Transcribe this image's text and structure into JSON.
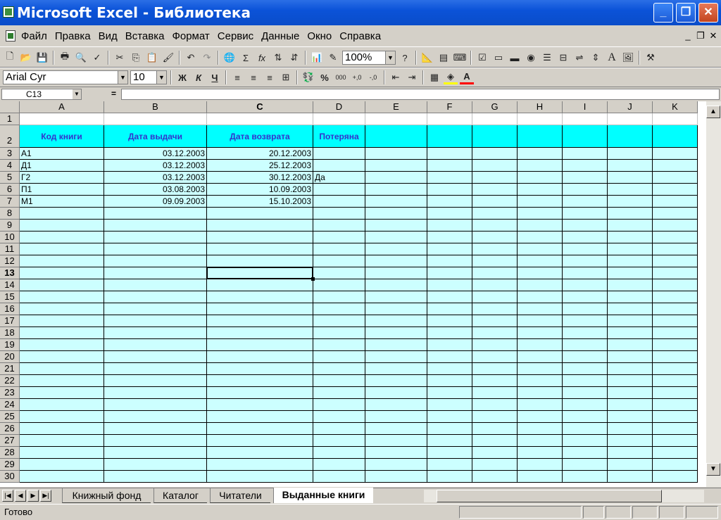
{
  "window": {
    "title": "Microsoft Excel - Библиотека"
  },
  "menu": {
    "items": [
      "Файл",
      "Правка",
      "Вид",
      "Вставка",
      "Формат",
      "Сервис",
      "Данные",
      "Окно",
      "Справка"
    ]
  },
  "toolbar": {
    "zoom": "100%",
    "font_name": "Arial Cyr",
    "font_size": "10",
    "bold_label": "Ж",
    "italic_label": "К",
    "underline_label": "Ч",
    "percent_label": "%",
    "thousands_label": "000",
    "sum_label": "Σ",
    "fx_label": "fx"
  },
  "formula_bar": {
    "name_box": "C13",
    "equals": "=",
    "value": ""
  },
  "grid": {
    "columns": [
      "A",
      "B",
      "C",
      "D",
      "E",
      "F",
      "G",
      "H",
      "I",
      "J",
      "K"
    ],
    "rows": [
      "1",
      "2",
      "3",
      "4",
      "5",
      "6",
      "7",
      "8",
      "9",
      "10",
      "11",
      "12",
      "13",
      "14",
      "15",
      "16",
      "17",
      "18",
      "19",
      "20",
      "21",
      "22",
      "23",
      "24",
      "25",
      "26",
      "27",
      "28",
      "29",
      "30"
    ],
    "selected_cell": "C13",
    "header_row": [
      "Код книги",
      "Дата выдачи",
      "Дата возврата",
      "Потеряна"
    ],
    "data": [
      [
        "А1",
        "03.12.2003",
        "20.12.2003",
        ""
      ],
      [
        "Д1",
        "03.12.2003",
        "25.12.2003",
        ""
      ],
      [
        "Г2",
        "03.12.2003",
        "30.12.2003",
        "Да"
      ],
      [
        "П1",
        "03.08.2003",
        "10.09.2003",
        ""
      ],
      [
        "М1",
        "09.09.2003",
        "15.10.2003",
        ""
      ]
    ],
    "colors": {
      "header_fill": "#00ffff",
      "header_text": "#3333cc",
      "body_fill": "#ccffff"
    }
  },
  "sheets": {
    "tabs": [
      "Книжный фонд",
      "Каталог",
      "Читатели",
      "Выданные книги"
    ],
    "active": "Выданные книги"
  },
  "status": {
    "text": "Готово"
  }
}
